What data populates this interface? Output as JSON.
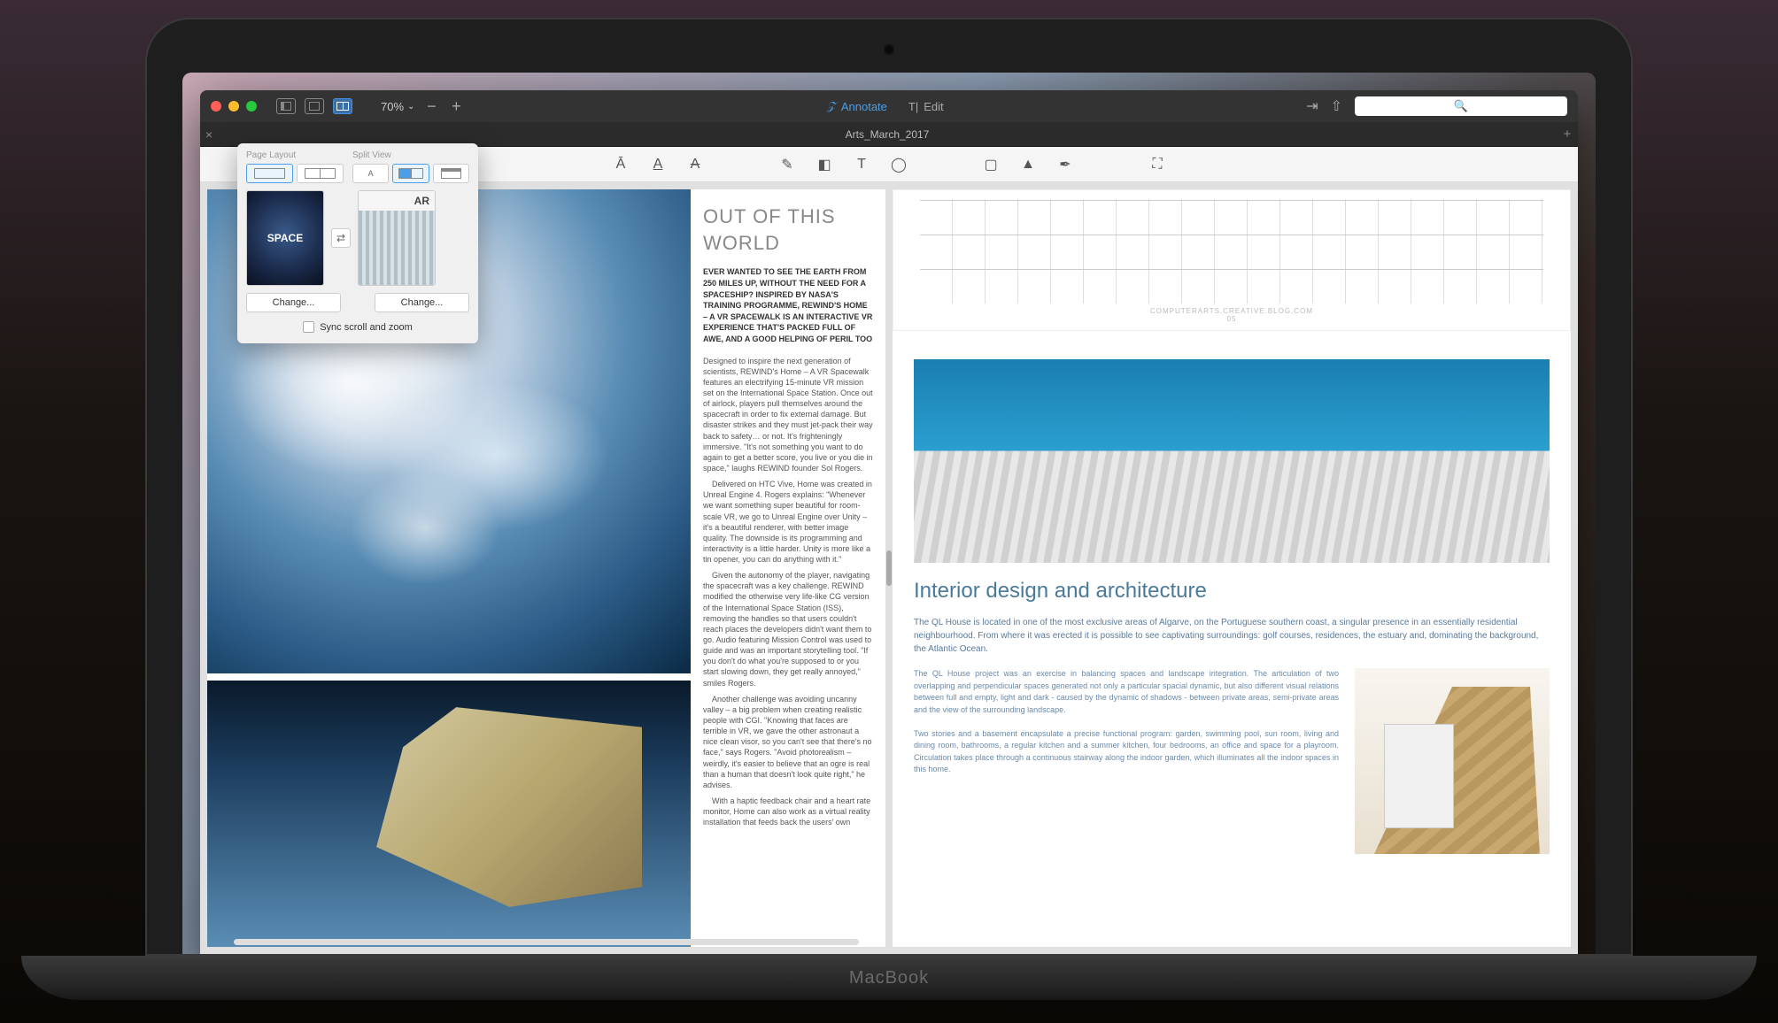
{
  "titlebar": {
    "zoom": "70%",
    "annotate_label": "Annotate",
    "edit_label": "Edit"
  },
  "tab": {
    "title": "Arts_March_2017"
  },
  "search": {
    "placeholder": ""
  },
  "popover": {
    "page_layout_label": "Page Layout",
    "split_view_label": "Split View",
    "thumb_left_label": "SPACE",
    "thumb_right_label": "AR",
    "change_label": "Change...",
    "sync_label": "Sync scroll and zoom"
  },
  "left_doc": {
    "title": "OUT OF THIS WORLD",
    "lead": "EVER WANTED TO SEE THE EARTH FROM 250 MILES UP, WITHOUT THE NEED FOR A SPACESHIP? INSPIRED BY NASA'S TRAINING PROGRAMME, REWIND'S HOME – A VR SPACEWALK IS AN INTERACTIVE VR EXPERIENCE THAT'S PACKED FULL OF AWE, AND A GOOD HELPING OF PERIL TOO",
    "body": [
      "Designed to inspire the next generation of scientists, REWIND's Home – A VR Spacewalk features an electrifying 15-minute VR mission set on the International Space Station. Once out of airlock, players pull themselves around the spacecraft in order to fix external damage. But disaster strikes and they must jet-pack their way back to safety… or not. It's frighteningly immersive. \"It's not something you want to do again to get a better score, you live or you die in space,\" laughs REWIND founder Sol Rogers.",
      "Delivered on HTC Vive, Home was created in Unreal Engine 4. Rogers explains: \"Whenever we want something super beautiful for room-scale VR, we go to Unreal Engine over Unity – it's a beautiful renderer, with better image quality. The downside is its programming and interactivity is a little harder. Unity is more like a tin opener, you can do anything with it.\"",
      "Given the autonomy of the player, navigating the spacecraft was a key challenge. REWIND modified the otherwise very life-like CG version of the International Space Station (ISS), removing the handles so that users couldn't reach places the developers didn't want them to go. Audio featuring Mission Control was used to guide and was an important storytelling tool. \"If you don't do what you're supposed to or you start slowing down, they get really annoyed,\" smiles Rogers.",
      "Another challenge was avoiding uncanny valley – a big problem when creating realistic people with CGI. \"Knowing that faces are terrible in VR, we gave the other astronaut a nice clean visor, so you can't see that there's no face,\" says Rogers. \"Avoid photorealism – weirdly, it's easier to believe that an ogre is real than a human that doesn't look quite right,\" he advises.",
      "With a haptic feedback chair and a heart rate monitor, Home can also work as a virtual reality installation that feeds back the users' own"
    ]
  },
  "right_doc": {
    "arch_footer": "COMPUTERARTS.CREATIVE.BLOG.COM",
    "arch_page": "05",
    "heading": "Interior design and architecture",
    "intro": "The QL House is located in one of the most exclusive areas of Algarve, on the Portuguese southern coast, a singular presence in an essentially residential neighbourhood. From where it was erected it is possible to see captivating surroundings: golf courses, residences, the estuary and, dominating the background, the Atlantic Ocean.",
    "col": "The QL House project was an exercise in balancing spaces and landscape integration. The articulation of two overlapping and perpendicular spaces generated not only a particular spacial dynamic, but also different visual relations between full and empty, light and dark - caused by the dynamic of shadows - between private areas, semi-private areas and the view of the surrounding landscape.",
    "col2": "Two stories and a basement encapsulate a precise functional program: garden, swimming pool, sun room, living and dining room, bathrooms, a regular kitchen and a summer kitchen, four bedrooms, an office and space for a playroom. Circulation takes place through a continuous stairway along the indoor garden, which illuminates all the indoor spaces in this home."
  }
}
